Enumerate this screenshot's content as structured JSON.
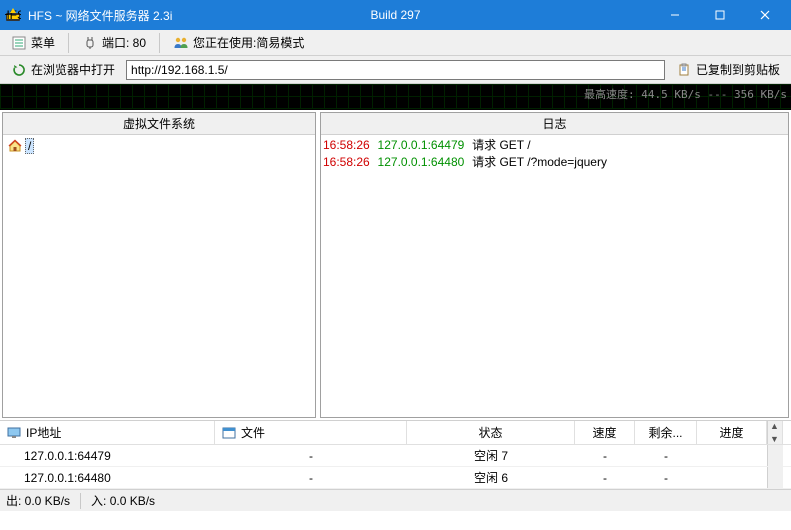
{
  "title": "HFS ~ 网络文件服务器 2.3i",
  "build": "Build 297",
  "toolbar1": {
    "menu": "菜单",
    "port_label": "端口: 80",
    "mode_label": "您正在使用:简易模式"
  },
  "toolbar2": {
    "open_browser": "在浏览器中打开",
    "url": "http://192.168.1.5/",
    "copied": "已复制到剪贴板"
  },
  "graph": {
    "text": "最高速度: 44.5 KB/s --- 356 KB/s"
  },
  "panes": {
    "vfs_title": "虚拟文件系统",
    "log_title": "日志",
    "vfs_root": "/"
  },
  "log": [
    {
      "time": "16:58:26",
      "ip": "127.0.0.1:64479",
      "text": "请求 GET /"
    },
    {
      "time": "16:58:26",
      "ip": "127.0.0.1:64480",
      "text": "请求 GET /?mode=jquery"
    }
  ],
  "conn_headers": {
    "ip": "IP地址",
    "file": "文件",
    "status": "状态",
    "speed": "速度",
    "remain": "剩余...",
    "progress": "进度"
  },
  "connections": [
    {
      "ip": "127.0.0.1:64479",
      "file": "-",
      "status": "空闲 7",
      "speed": "-",
      "remain": "-",
      "progress": ""
    },
    {
      "ip": "127.0.0.1:64480",
      "file": "-",
      "status": "空闲 6",
      "speed": "-",
      "remain": "-",
      "progress": ""
    }
  ],
  "status": {
    "out": "出: 0.0 KB/s",
    "in": "入: 0.0 KB/s"
  }
}
